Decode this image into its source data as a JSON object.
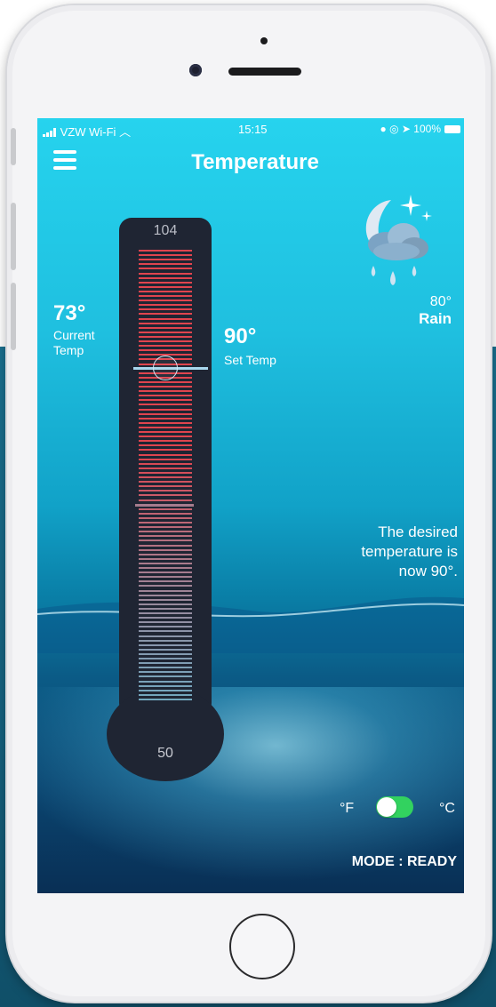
{
  "status_bar": {
    "carrier": "VZW Wi-Fi",
    "time": "15:15",
    "battery": "100%"
  },
  "header": {
    "title": "Temperature",
    "menu_icon": "hamburger-menu-icon"
  },
  "weather": {
    "icon": "moon-cloud-rain-icon",
    "temp": "80°",
    "condition": "Rain"
  },
  "current": {
    "value": "73°",
    "label": "Current Temp"
  },
  "setpoint": {
    "value": "90°",
    "label": "Set Temp"
  },
  "thermometer": {
    "max_label": "104",
    "min_label": "50",
    "max": 104,
    "min": 50,
    "current": 73,
    "set": 90,
    "colors": {
      "hot": "#e0444e",
      "cold": "#8fd3ee",
      "tube": "#1f2533"
    }
  },
  "message": "The desired temperature is now 90°.",
  "units": {
    "fahrenheit": "°F",
    "celsius": "°C",
    "toggle_on": true,
    "toggle_color": "#32d25f"
  },
  "mode": "MODE : READY"
}
